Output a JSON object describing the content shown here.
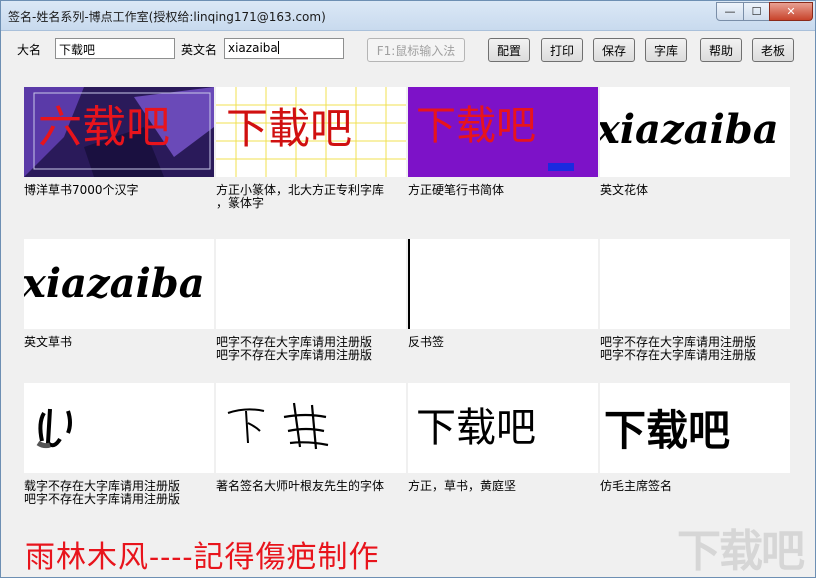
{
  "window": {
    "title": "签名-姓名系列-博点工作室(授权给:linqing171@163.com)",
    "minimize_glyph": "—",
    "maximize_glyph": "☐",
    "close_glyph": "✕"
  },
  "form": {
    "name_label": "大名",
    "name_value": "下载吧",
    "english_label": "英文名",
    "english_value": "xiazaiba"
  },
  "toolbar": {
    "f1_label": "F1:鼠标输入法",
    "config_label": "配置",
    "print_label": "打印",
    "save_label": "保存",
    "font_lib_label": "字库",
    "help_label": "帮助",
    "boss_label": "老板"
  },
  "signatures": [
    {
      "preview": "博洋 calligraphy red on purple",
      "glyphs": "六载吧",
      "caption": [
        "博洋草书7000个汉字"
      ]
    },
    {
      "preview": "seal script red on grid",
      "glyphs": "下載吧",
      "caption": [
        "方正小篆体，北大方正专利字库",
        "，篆体字"
      ]
    },
    {
      "preview": "hard pen red on violet",
      "glyphs": "下载吧",
      "caption": [
        "方正硬笔行书简体"
      ]
    },
    {
      "preview": "english flourish",
      "glyphs": "xiazaiba",
      "caption": [
        "英文花体"
      ]
    },
    {
      "preview": "english cursive",
      "glyphs": "xiazaiba",
      "caption": [
        "英文草书"
      ]
    },
    {
      "preview": "blank",
      "glyphs": "",
      "caption": [
        "吧字不存在大字库请用注册版",
        "吧字不存在大字库请用注册版"
      ]
    },
    {
      "preview": "single stroke",
      "glyphs": "",
      "caption": [
        "反书签"
      ]
    },
    {
      "preview": "blank",
      "glyphs": "",
      "caption": [
        "吧字不存在大字库请用注册版",
        "吧字不存在大字库请用注册版"
      ]
    },
    {
      "preview": "fragment",
      "glyphs": "",
      "caption": [
        "载字不存在大字库请用注册版",
        "吧字不存在大字库请用注册版"
      ]
    },
    {
      "preview": "master signature",
      "glyphs": "",
      "caption": [
        "著名签名大师叶根友先生的字体"
      ]
    },
    {
      "preview": "black cursive",
      "glyphs": "下载吧",
      "caption": [
        "方正，草书，黄庭坚"
      ]
    },
    {
      "preview": "bold brush",
      "glyphs": "下载吧",
      "caption": [
        "仿毛主席签名"
      ]
    }
  ],
  "footer": {
    "credit": "雨林木风----記得傷疤制作",
    "watermark": "下载吧"
  },
  "colors": {
    "titlebar": "#c8daee",
    "red_ink": "#e8141c",
    "purple_bg": "#4a2a8a",
    "violet_bg": "#7d12c8"
  }
}
